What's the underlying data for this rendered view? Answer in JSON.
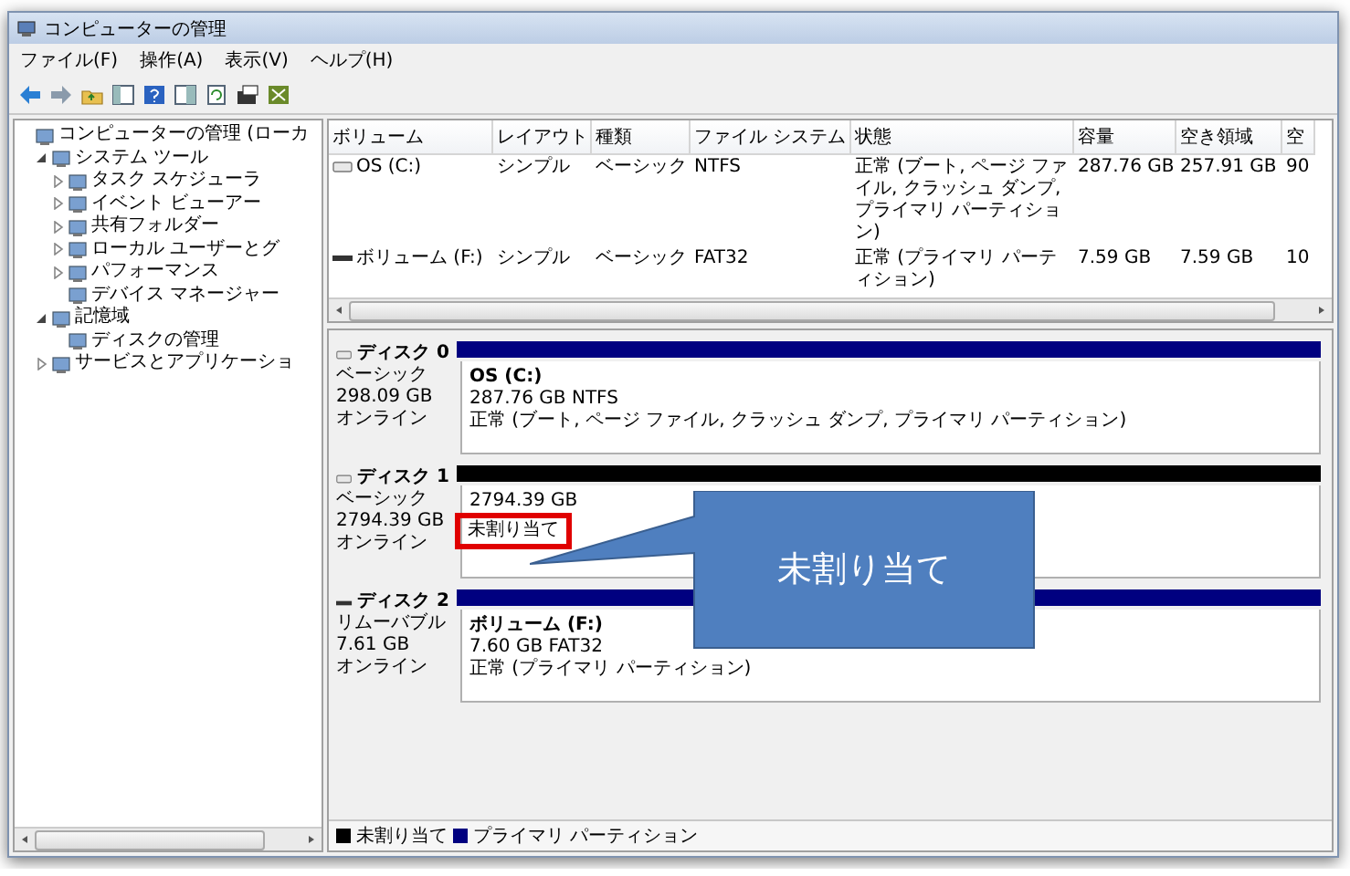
{
  "window": {
    "title": "コンピューターの管理"
  },
  "menu": [
    "ファイル(F)",
    "操作(A)",
    "表示(V)",
    "ヘルプ(H)"
  ],
  "tree": [
    {
      "label": "コンピューターの管理 (ローカ",
      "children": [
        {
          "label": "システム ツール",
          "expanded": true,
          "children": [
            {
              "label": "タスク スケジューラ",
              "expanded": false
            },
            {
              "label": "イベント ビューアー",
              "expanded": false
            },
            {
              "label": "共有フォルダー",
              "expanded": false
            },
            {
              "label": "ローカル ユーザーとグ",
              "expanded": false
            },
            {
              "label": "パフォーマンス",
              "expanded": false
            },
            {
              "label": "デバイス マネージャー"
            }
          ]
        },
        {
          "label": "記憶域",
          "expanded": true,
          "children": [
            {
              "label": "ディスクの管理"
            }
          ]
        },
        {
          "label": "サービスとアプリケーショ",
          "expanded": false
        }
      ]
    }
  ],
  "volumes": {
    "columns": [
      "ボリューム",
      "レイアウト",
      "種類",
      "ファイル システム",
      "状態",
      "容量",
      "空き領域",
      "空"
    ],
    "rows": [
      {
        "kind": "fixed",
        "cells": [
          "OS (C:)",
          "シンプル",
          "ベーシック",
          "NTFS",
          "正常 (ブート, ページ ファイル, クラッシュ ダンプ, プライマリ パーティション)",
          "287.76 GB",
          "257.91 GB",
          "90"
        ]
      },
      {
        "kind": "removable",
        "cells": [
          "ボリューム (F:)",
          "シンプル",
          "ベーシック",
          "FAT32",
          "正常 (プライマリ パーティション)",
          "7.59 GB",
          "7.59 GB",
          "10"
        ]
      }
    ]
  },
  "disks": [
    {
      "kind": "fixed",
      "name": "ディスク 0",
      "type": "ベーシック",
      "size": "298.09 GB",
      "status": "オンライン",
      "partitions": [
        {
          "kind": "primary",
          "name": "OS (C:)",
          "size": "287.76 GB NTFS",
          "status": "正常 (ブート, ページ ファイル, クラッシュ ダンプ, プライマリ パーティション)",
          "highlighted": false
        }
      ]
    },
    {
      "kind": "fixed",
      "name": "ディスク 1",
      "type": "ベーシック",
      "size": "2794.39 GB",
      "status": "オンライン",
      "partitions": [
        {
          "kind": "unallocated",
          "size": "2794.39 GB",
          "status": "未割り当て",
          "highlighted": true
        }
      ]
    },
    {
      "kind": "removable",
      "name": "ディスク 2",
      "type": "リムーバブル",
      "size": "7.61 GB",
      "status": "オンライン",
      "partitions": [
        {
          "kind": "primary",
          "name": "ボリューム (F:)",
          "size": "7.60 GB FAT32",
          "status": "正常 (プライマリ パーティション)",
          "highlighted": false
        }
      ]
    }
  ],
  "legend": [
    {
      "label": "未割り当て",
      "color": "#000000"
    },
    {
      "label": "プライマリ パーティション",
      "color": "#000080"
    }
  ],
  "callout": {
    "text": "未割り当て"
  }
}
